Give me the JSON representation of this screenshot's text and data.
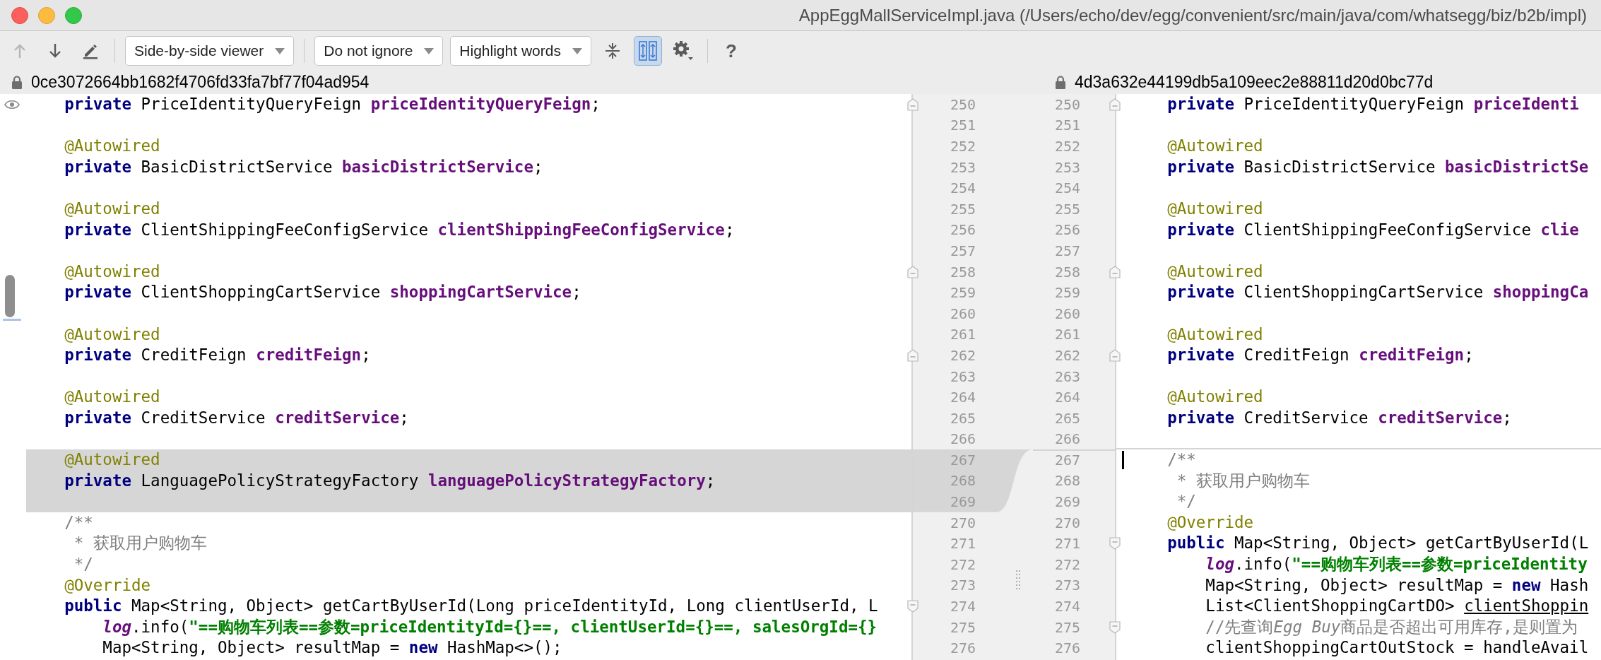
{
  "window": {
    "title": "AppEggMallServiceImpl.java (/Users/echo/dev/egg/convenient/src/main/java/com/whatsegg/biz/b2b/impl)"
  },
  "toolbar": {
    "groups": [
      {
        "items": [
          {
            "kind": "up_arrow",
            "disabled": true,
            "selected": false
          },
          {
            "kind": "down_arrow",
            "disabled": false,
            "selected": false
          },
          {
            "kind": "pencil",
            "disabled": false,
            "selected": false
          }
        ]
      },
      {
        "items": [
          {
            "kind": "dropdown",
            "label": "Side-by-side viewer",
            "disabled": false,
            "selected": false
          }
        ]
      },
      {
        "items": [
          {
            "kind": "dropdown",
            "label": "Do not ignore",
            "disabled": false,
            "selected": false
          },
          {
            "kind": "dropdown",
            "label": "Highlight words",
            "disabled": false,
            "selected": false
          },
          {
            "kind": "collapse",
            "disabled": false,
            "selected": false
          },
          {
            "kind": "sync_scroll",
            "disabled": false,
            "selected": true
          },
          {
            "kind": "settings",
            "disabled": false,
            "selected": false
          }
        ]
      },
      {
        "items": [
          {
            "kind": "text_button",
            "label": "?",
            "disabled": false,
            "selected": false
          }
        ]
      }
    ]
  },
  "left": {
    "revision": "0ce3072664bb1682f4706fd33fa7bf77f04ad954",
    "lines": [
      {
        "number": "250",
        "fold_start": true,
        "fold_end": false,
        "changed": false,
        "tokens": [
          {
            "kind": "keyword",
            "text": "    private"
          },
          {
            "kind": "plain",
            "text": " PriceIdentityQueryFeign "
          },
          {
            "kind": "field",
            "text": "priceIdentityQueryFeign"
          },
          {
            "kind": "plain",
            "text": ";"
          }
        ]
      },
      {
        "number": "251",
        "fold_start": false,
        "fold_end": false,
        "changed": false
      },
      {
        "number": "252",
        "fold_start": false,
        "fold_end": false,
        "changed": false,
        "tokens": [
          {
            "kind": "annotation",
            "text": "    @Autowired"
          }
        ]
      },
      {
        "number": "253",
        "fold_start": false,
        "fold_end": false,
        "changed": false,
        "tokens": [
          {
            "kind": "keyword",
            "text": "    private"
          },
          {
            "kind": "plain",
            "text": " BasicDistrictService "
          },
          {
            "kind": "field",
            "text": "basicDistrictService"
          },
          {
            "kind": "plain",
            "text": ";"
          }
        ]
      },
      {
        "number": "254",
        "fold_start": false,
        "fold_end": false,
        "changed": false
      },
      {
        "number": "255",
        "fold_start": false,
        "fold_end": false,
        "changed": false,
        "tokens": [
          {
            "kind": "annotation",
            "text": "    @Autowired"
          }
        ]
      },
      {
        "number": "256",
        "fold_start": false,
        "fold_end": false,
        "changed": false,
        "tokens": [
          {
            "kind": "keyword",
            "text": "    private"
          },
          {
            "kind": "plain",
            "text": " ClientShippingFeeConfigService "
          },
          {
            "kind": "field",
            "text": "clientShippingFeeConfigService"
          },
          {
            "kind": "plain",
            "text": ";"
          }
        ]
      },
      {
        "number": "257",
        "fold_start": false,
        "fold_end": false,
        "changed": false
      },
      {
        "number": "258",
        "fold_start": true,
        "fold_end": false,
        "changed": false,
        "tokens": [
          {
            "kind": "annotation",
            "text": "    @Autowired"
          }
        ]
      },
      {
        "number": "259",
        "fold_start": false,
        "fold_end": false,
        "changed": false,
        "tokens": [
          {
            "kind": "keyword",
            "text": "    private"
          },
          {
            "kind": "plain",
            "text": " ClientShoppingCartService "
          },
          {
            "kind": "field",
            "text": "shoppingCartService"
          },
          {
            "kind": "plain",
            "text": ";"
          }
        ]
      },
      {
        "number": "260",
        "fold_start": false,
        "fold_end": false,
        "changed": false
      },
      {
        "number": "261",
        "fold_start": false,
        "fold_end": false,
        "changed": false,
        "tokens": [
          {
            "kind": "annotation",
            "text": "    @Autowired"
          }
        ]
      },
      {
        "number": "262",
        "fold_start": true,
        "fold_end": false,
        "changed": false,
        "tokens": [
          {
            "kind": "keyword",
            "text": "    private"
          },
          {
            "kind": "plain",
            "text": " CreditFeign "
          },
          {
            "kind": "field",
            "text": "creditFeign"
          },
          {
            "kind": "plain",
            "text": ";"
          }
        ]
      },
      {
        "number": "263",
        "fold_start": false,
        "fold_end": false,
        "changed": false
      },
      {
        "number": "264",
        "fold_start": false,
        "fold_end": false,
        "changed": false,
        "tokens": [
          {
            "kind": "annotation",
            "text": "    @Autowired"
          }
        ]
      },
      {
        "number": "265",
        "fold_start": false,
        "fold_end": false,
        "changed": false,
        "tokens": [
          {
            "kind": "keyword",
            "text": "    private"
          },
          {
            "kind": "plain",
            "text": " CreditService "
          },
          {
            "kind": "field",
            "text": "creditService"
          },
          {
            "kind": "plain",
            "text": ";"
          }
        ]
      },
      {
        "number": "266",
        "fold_start": false,
        "fold_end": false,
        "changed": false
      },
      {
        "number": "267",
        "fold_start": false,
        "fold_end": false,
        "changed": true,
        "tokens": [
          {
            "kind": "annotation",
            "text": "    @Autowired"
          }
        ]
      },
      {
        "number": "268",
        "fold_start": false,
        "fold_end": false,
        "changed": true,
        "tokens": [
          {
            "kind": "keyword",
            "text": "    private"
          },
          {
            "kind": "plain",
            "text": " LanguagePolicyStrategyFactory "
          },
          {
            "kind": "field",
            "text": "languagePolicyStrategyFactory"
          },
          {
            "kind": "plain",
            "text": ";"
          }
        ]
      },
      {
        "number": "269",
        "fold_start": false,
        "fold_end": false,
        "changed": true
      },
      {
        "number": "270",
        "fold_start": false,
        "fold_end": false,
        "changed": false,
        "tokens": [
          {
            "kind": "comment",
            "text": "    /**"
          }
        ]
      },
      {
        "number": "271",
        "fold_start": false,
        "fold_end": false,
        "changed": false,
        "tokens": [
          {
            "kind": "comment",
            "text": "     * 获取用户购物车"
          }
        ]
      },
      {
        "number": "272",
        "fold_start": false,
        "fold_end": false,
        "changed": false,
        "tokens": [
          {
            "kind": "comment",
            "text": "     */"
          }
        ]
      },
      {
        "number": "273",
        "fold_start": false,
        "fold_end": false,
        "changed": false,
        "tokens": [
          {
            "kind": "annotation",
            "text": "    @Override"
          }
        ]
      },
      {
        "number": "274",
        "fold_start": false,
        "fold_end": true,
        "changed": false,
        "tokens": [
          {
            "kind": "keyword",
            "text": "    public"
          },
          {
            "kind": "plain",
            "text": " Map<String, Object> getCartByUserId(Long priceIdentityId, Long clientUserId, L"
          }
        ]
      },
      {
        "number": "275",
        "fold_start": false,
        "fold_end": false,
        "changed": false,
        "tokens": [
          {
            "kind": "static_field",
            "text": "        log"
          },
          {
            "kind": "plain",
            "text": ".info("
          },
          {
            "kind": "string",
            "text": "\"==购物车列表==参数=priceIdentityId={}==, clientUserId={}==, salesOrgId={}"
          }
        ]
      },
      {
        "number": "276",
        "fold_start": false,
        "fold_end": false,
        "changed": false,
        "tokens": [
          {
            "kind": "plain",
            "text": "        Map<String, Object> resultMap = "
          },
          {
            "kind": "keyword",
            "text": "new"
          },
          {
            "kind": "plain",
            "text": " HashMap<>();"
          }
        ]
      }
    ]
  },
  "right": {
    "revision": "4d3a632e44199db5a109eec2e88811d20d0bc77d",
    "lines": [
      {
        "number": "250",
        "fold_start": true,
        "fold_end": false,
        "insert_above": false,
        "caret": false,
        "tokens": [
          {
            "kind": "keyword",
            "text": "    private"
          },
          {
            "kind": "plain",
            "text": " PriceIdentityQueryFeign "
          },
          {
            "kind": "field",
            "text": "priceIdenti"
          }
        ]
      },
      {
        "number": "251",
        "fold_start": false,
        "fold_end": false,
        "insert_above": false,
        "caret": false
      },
      {
        "number": "252",
        "fold_start": false,
        "fold_end": false,
        "insert_above": false,
        "caret": false,
        "tokens": [
          {
            "kind": "annotation",
            "text": "    @Autowired"
          }
        ]
      },
      {
        "number": "253",
        "fold_start": false,
        "fold_end": false,
        "insert_above": false,
        "caret": false,
        "tokens": [
          {
            "kind": "keyword",
            "text": "    private"
          },
          {
            "kind": "plain",
            "text": " BasicDistrictService "
          },
          {
            "kind": "field",
            "text": "basicDistrictSe"
          }
        ]
      },
      {
        "number": "254",
        "fold_start": false,
        "fold_end": false,
        "insert_above": false,
        "caret": false
      },
      {
        "number": "255",
        "fold_start": false,
        "fold_end": false,
        "insert_above": false,
        "caret": false,
        "tokens": [
          {
            "kind": "annotation",
            "text": "    @Autowired"
          }
        ]
      },
      {
        "number": "256",
        "fold_start": false,
        "fold_end": false,
        "insert_above": false,
        "caret": false,
        "tokens": [
          {
            "kind": "keyword",
            "text": "    private"
          },
          {
            "kind": "plain",
            "text": " ClientShippingFeeConfigService "
          },
          {
            "kind": "field",
            "text": "clie"
          }
        ]
      },
      {
        "number": "257",
        "fold_start": false,
        "fold_end": false,
        "insert_above": false,
        "caret": false
      },
      {
        "number": "258",
        "fold_start": true,
        "fold_end": false,
        "insert_above": false,
        "caret": false,
        "tokens": [
          {
            "kind": "annotation",
            "text": "    @Autowired"
          }
        ]
      },
      {
        "number": "259",
        "fold_start": false,
        "fold_end": false,
        "insert_above": false,
        "caret": false,
        "tokens": [
          {
            "kind": "keyword",
            "text": "    private"
          },
          {
            "kind": "plain",
            "text": " ClientShoppingCartService "
          },
          {
            "kind": "field",
            "text": "shoppingCa"
          }
        ]
      },
      {
        "number": "260",
        "fold_start": false,
        "fold_end": false,
        "insert_above": false,
        "caret": false
      },
      {
        "number": "261",
        "fold_start": false,
        "fold_end": false,
        "insert_above": false,
        "caret": false,
        "tokens": [
          {
            "kind": "annotation",
            "text": "    @Autowired"
          }
        ]
      },
      {
        "number": "262",
        "fold_start": true,
        "fold_end": false,
        "insert_above": false,
        "caret": false,
        "tokens": [
          {
            "kind": "keyword",
            "text": "    private"
          },
          {
            "kind": "plain",
            "text": " CreditFeign "
          },
          {
            "kind": "field",
            "text": "creditFeign"
          },
          {
            "kind": "plain",
            "text": ";"
          }
        ]
      },
      {
        "number": "263",
        "fold_start": false,
        "fold_end": false,
        "insert_above": false,
        "caret": false
      },
      {
        "number": "264",
        "fold_start": false,
        "fold_end": false,
        "insert_above": false,
        "caret": false,
        "tokens": [
          {
            "kind": "annotation",
            "text": "    @Autowired"
          }
        ]
      },
      {
        "number": "265",
        "fold_start": false,
        "fold_end": false,
        "insert_above": false,
        "caret": false,
        "tokens": [
          {
            "kind": "keyword",
            "text": "    private"
          },
          {
            "kind": "plain",
            "text": " CreditService "
          },
          {
            "kind": "field",
            "text": "creditService"
          },
          {
            "kind": "plain",
            "text": ";"
          }
        ]
      },
      {
        "number": "266",
        "fold_start": false,
        "fold_end": false,
        "insert_above": false,
        "caret": false
      },
      {
        "number": "267",
        "fold_start": false,
        "fold_end": false,
        "insert_above": true,
        "caret": true,
        "tokens": [
          {
            "kind": "comment",
            "text": "    /**"
          }
        ]
      },
      {
        "number": "268",
        "fold_start": false,
        "fold_end": false,
        "insert_above": false,
        "caret": false,
        "tokens": [
          {
            "kind": "comment",
            "text": "     * 获取用户购物车"
          }
        ]
      },
      {
        "number": "269",
        "fold_start": false,
        "fold_end": false,
        "insert_above": false,
        "caret": false,
        "tokens": [
          {
            "kind": "comment",
            "text": "     */"
          }
        ]
      },
      {
        "number": "270",
        "fold_start": false,
        "fold_end": false,
        "insert_above": false,
        "caret": false,
        "tokens": [
          {
            "kind": "annotation",
            "text": "    @Override"
          }
        ]
      },
      {
        "number": "271",
        "fold_start": false,
        "fold_end": true,
        "insert_above": false,
        "caret": false,
        "tokens": [
          {
            "kind": "keyword",
            "text": "    public"
          },
          {
            "kind": "plain",
            "text": " Map<String, Object> getCartByUserId(L"
          }
        ]
      },
      {
        "number": "272",
        "fold_start": false,
        "fold_end": false,
        "insert_above": false,
        "caret": false,
        "tokens": [
          {
            "kind": "static_field",
            "text": "        log"
          },
          {
            "kind": "plain",
            "text": ".info("
          },
          {
            "kind": "string",
            "text": "\"==购物车列表==参数=priceIdentity"
          }
        ]
      },
      {
        "number": "273",
        "fold_start": false,
        "fold_end": false,
        "insert_above": false,
        "caret": false,
        "tokens": [
          {
            "kind": "plain",
            "text": "        Map<String, Object> resultMap = "
          },
          {
            "kind": "keyword",
            "text": "new"
          },
          {
            "kind": "plain",
            "text": " Hash"
          }
        ]
      },
      {
        "number": "274",
        "fold_start": false,
        "fold_end": false,
        "insert_above": false,
        "caret": false,
        "tokens": [
          {
            "kind": "plain",
            "text": "        List<ClientShoppingCartDO> "
          },
          {
            "kind": "underlined",
            "text": "clientShoppin"
          }
        ]
      },
      {
        "number": "275",
        "fold_start": false,
        "fold_end": true,
        "insert_above": false,
        "caret": false,
        "tokens": [
          {
            "kind": "comment",
            "text": "        //先查询"
          },
          {
            "kind": "comment_italic",
            "text": "Egg Buy"
          },
          {
            "kind": "comment",
            "text": "商品是否超出可用库存,是则置为"
          }
        ]
      },
      {
        "number": "276",
        "fold_start": false,
        "fold_end": false,
        "insert_above": false,
        "caret": false,
        "tokens": [
          {
            "kind": "plain",
            "text": "        clientShoppingCartOutStock = handleAvail"
          }
        ]
      }
    ]
  }
}
